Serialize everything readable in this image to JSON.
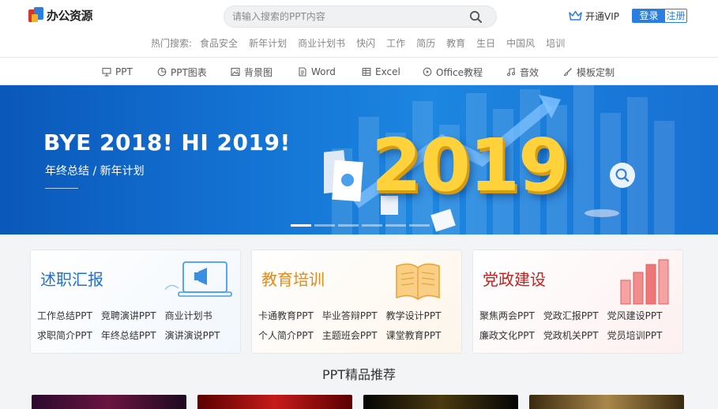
{
  "header": {
    "logo_text": "办公资源",
    "search_placeholder": "请输入搜索的PPT内容",
    "vip_label": "开通VIP",
    "login_label": "登录",
    "register_label": "注册"
  },
  "hot_search": {
    "label": "热门搜索:",
    "items": [
      "食品安全",
      "新年计划",
      "商业计划书",
      "快闪",
      "工作",
      "简历",
      "教育",
      "生日",
      "中国风",
      "培训"
    ]
  },
  "categories": [
    {
      "label": "PPT",
      "icon": "presentation-icon"
    },
    {
      "label": "PPT图表",
      "icon": "pie-chart-icon"
    },
    {
      "label": "背景图",
      "icon": "image-icon"
    },
    {
      "label": "Word",
      "icon": "word-doc-icon"
    },
    {
      "label": "Excel",
      "icon": "excel-table-icon"
    },
    {
      "label": "Office教程",
      "icon": "play-circle-icon"
    },
    {
      "label": "音效",
      "icon": "music-note-icon"
    },
    {
      "label": "模板定制",
      "icon": "brush-icon"
    }
  ],
  "banner": {
    "title": "BYE 2018!  HI 2019!",
    "subtitle": "年终总结 / 新年计划",
    "year": "2019",
    "slide_count": 6,
    "active_slide": 1
  },
  "cards": [
    {
      "title": "述职汇报",
      "color": "#1f6fd0",
      "rows": [
        [
          "工作总结PPT",
          "竞聘演讲PPT",
          "商业计划书"
        ],
        [
          "求职简介PPT",
          "年终总结PPT",
          "演讲演说PPT"
        ]
      ]
    },
    {
      "title": "教育培训",
      "color": "#e08a1e",
      "rows": [
        [
          "卡通教育PPT",
          "毕业答辩PPT",
          "教学设计PPT"
        ],
        [
          "个人简介PPT",
          "主题班会PPT",
          "课堂教育PPT"
        ]
      ]
    },
    {
      "title": "党政建设",
      "color": "#c6201f",
      "rows": [
        [
          "聚焦两会PPT",
          "党政汇报PPT",
          "党风建设PPT"
        ],
        [
          "廉政文化PPT",
          "党政机关PPT",
          "党员培训PPT"
        ]
      ]
    }
  ],
  "section": {
    "title": "PPT精品推荐"
  },
  "colors": {
    "accent": "#2a7de1",
    "banner_bg": "#1473d4",
    "year_gold": "#ffd23c"
  }
}
